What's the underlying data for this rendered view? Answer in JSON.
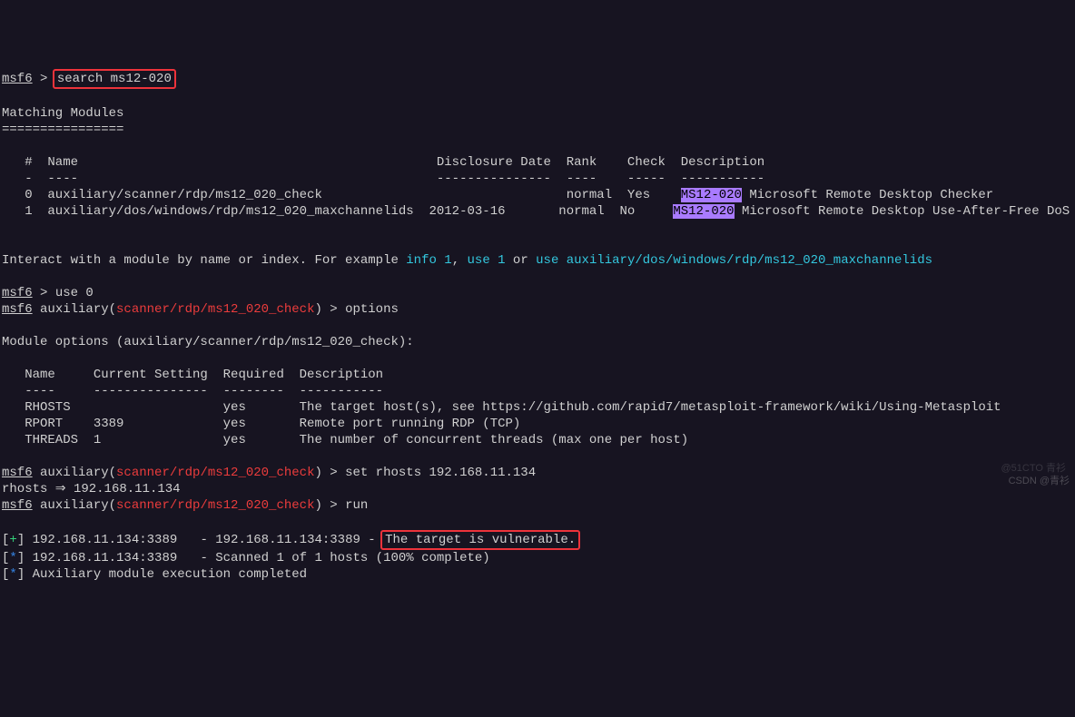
{
  "prompt1": {
    "msf": "msf6",
    "sep": " > ",
    "cmd": "search ms12-020"
  },
  "match_header": "Matching Modules",
  "match_uline": "================",
  "tbl": {
    "hdr": "   #  Name                                               Disclosure Date  Rank    Check  Description",
    "uline": "   -  ----                                               ---------------  ----    -----  -----------",
    "r0a": "   0  auxiliary/scanner/rdp/ms12_020_check                                normal  Yes    ",
    "r0tag": "MS12-020",
    "r0b": " Microsoft Remote Desktop Checker",
    "r1a": "   1  auxiliary/dos/windows/rdp/ms12_020_maxchannelids  2012-03-16       normal  No     ",
    "r1tag": "MS12-020",
    "r1b": " Microsoft Remote Desktop Use-After-Free DoS"
  },
  "interact": {
    "pre": "Interact with a module by name or index. For example ",
    "info": "info 1",
    "comma": ", ",
    "use1": "use 1",
    "or": " or ",
    "use2": "use auxiliary/dos/windows/rdp/ms12_020_maxchannelids"
  },
  "use0": {
    "msf": "msf6",
    "sep": " > ",
    "cmd": "use 0"
  },
  "aux": {
    "msf": "msf6",
    "pre": " auxiliary(",
    "mod": "scanner/rdp/ms12_020_check",
    "post": ") > "
  },
  "cmd_options": "options",
  "modopt_header": "Module options (auxiliary/scanner/rdp/ms12_020_check):",
  "opt": {
    "hdr": "   Name     Current Setting  Required  Description",
    "uline": "   ----     ---------------  --------  -----------",
    "r0": "   RHOSTS                    yes       The target host(s), see https://github.com/rapid7/metasploit-framework/wiki/Using-Metasploit",
    "r1": "   RPORT    3389             yes       Remote port running RDP (TCP)",
    "r2": "   THREADS  1                yes       The number of concurrent threads (max one per host)"
  },
  "cmd_set": "set rhosts 192.168.11.134",
  "rhosts_line": "rhosts ⇒ 192.168.11.134",
  "cmd_run": "run",
  "out": {
    "l1a": "[+]",
    "l1b": " 192.168.11.134:3389   - 192.168.11.134:3389 - ",
    "l1box": "The target is vulnerable.",
    "l2a": "[*]",
    "l2b": " 192.168.11.134:3389   - Scanned 1 of 1 hosts (100% complete)",
    "l3a": "[*]",
    "l3b": " Auxiliary module execution completed"
  },
  "watermark1": "@51CTO 青衫",
  "watermark2": "CSDN @青衫"
}
